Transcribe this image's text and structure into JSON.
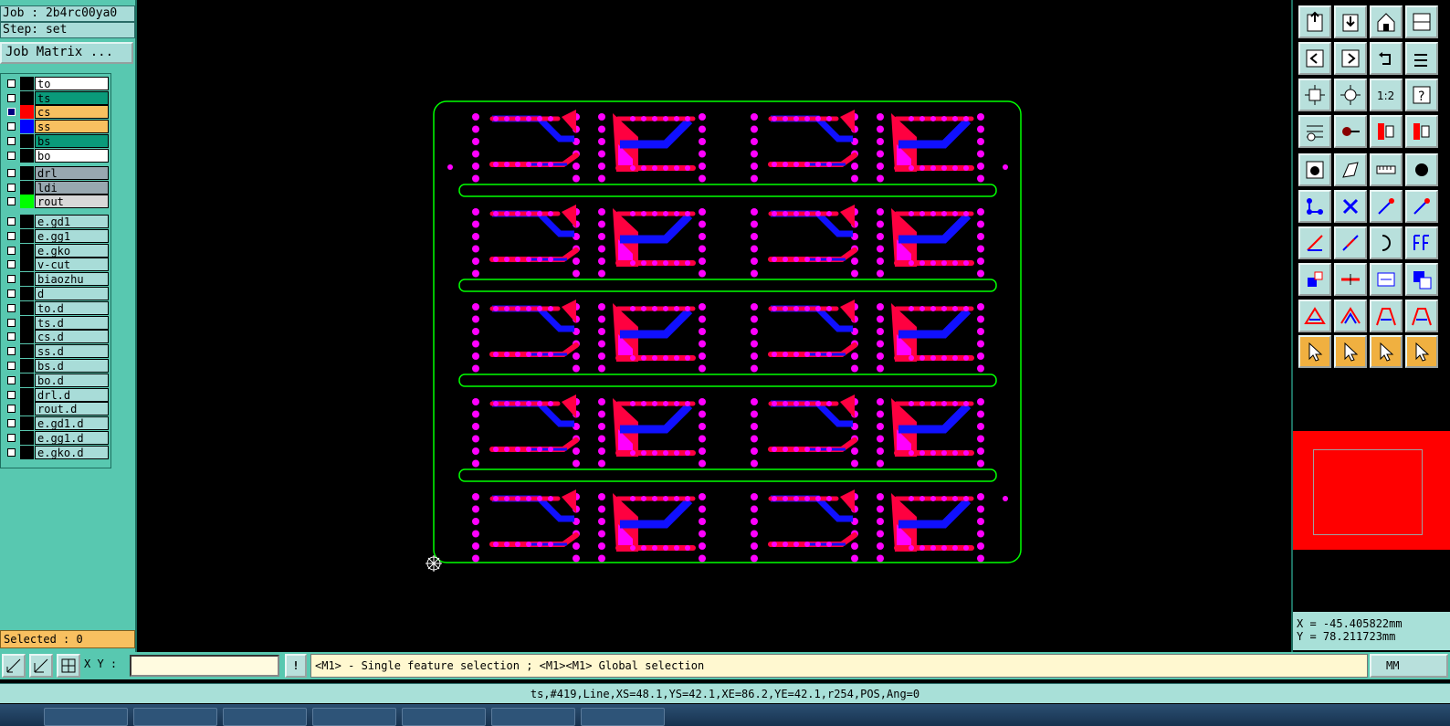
{
  "job_label": "Job : 2b4rc00ya0",
  "step_label": "Step: set",
  "job_matrix_button": "Job Matrix ...",
  "layers_board": [
    {
      "name": "to",
      "bg": "#ffffff",
      "swatch": "#000000",
      "checked": false
    },
    {
      "name": "ts",
      "bg": "#0a9a7a",
      "swatch": "#000000",
      "checked": false
    },
    {
      "name": "cs",
      "bg": "#f8c060",
      "swatch": "#ff0000",
      "checked": true
    },
    {
      "name": "ss",
      "bg": "#f8c060",
      "swatch": "#0000ff",
      "checked": false
    },
    {
      "name": "bs",
      "bg": "#0a9a7a",
      "swatch": "#000000",
      "checked": false
    },
    {
      "name": "bo",
      "bg": "#ffffff",
      "swatch": "#000000",
      "checked": false
    }
  ],
  "layers_misc": [
    {
      "name": "drl",
      "bg": "#98a8b0",
      "swatch": "#000000",
      "checked": false
    },
    {
      "name": "ldi",
      "bg": "#98a8b0",
      "swatch": "#000000",
      "checked": false
    },
    {
      "name": "rout",
      "bg": "#d8d8d8",
      "swatch": "#00ff00",
      "checked": false
    }
  ],
  "layers_doc": [
    "e.gd1",
    "e.gg1",
    "e.gko",
    "v-cut",
    "biaozhu",
    "d",
    "to.d",
    "ts.d",
    "cs.d",
    "ss.d",
    "bs.d",
    "bo.d",
    "drl.d",
    "rout.d",
    "e.gd1.d",
    "e.gg1.d",
    "e.gko.d"
  ],
  "selected_label": "Selected : 0",
  "coords": {
    "x": "X = -45.405822mm",
    "y": "Y = 78.211723mm"
  },
  "xy_label": "X Y :",
  "xy_value": "",
  "message": "<M1> - Single feature selection ; <M1><M1> Global selection",
  "units": "MM",
  "status": "ts,#419,Line,XS=48.1,YS=42.1,XE=86.2,YE=42.1,r254,POS,Ang=0",
  "toolbar_icons": [
    "open-icon",
    "save-icon",
    "home-icon",
    "window-icon",
    "prev-step-icon",
    "next-step-icon",
    "undo-icon",
    "redo-icon",
    "zoom-fit-icon",
    "zoom-home-icon",
    "one-to-one-icon",
    "help-icon",
    "pen-settings-icon",
    "probe-icon",
    "layers-red-icon",
    "layers-red2-icon",
    "add-pad-icon",
    "add-shape-icon",
    "measure-icon",
    "dot-icon",
    "connect-icon",
    "delete-icon",
    "move-icon",
    "copy-icon",
    "line-icon",
    "line2-icon",
    "arc-icon",
    "text-icon",
    "route-icon",
    "break-icon",
    "size-icon",
    "resize-icon",
    "triangle-icon",
    "triangle2-icon",
    "arrow-up-icon",
    "arrow-up2-icon",
    "pointer-icon",
    "pointer-select-icon",
    "pointer-rotate-icon",
    "pointer-route-icon"
  ],
  "colors": {
    "panel": "#58c8b0",
    "signal_top": "#ff0040",
    "signal_bottom": "#1010ff",
    "pad": "#ff00ff",
    "outline": "#00ff00"
  }
}
